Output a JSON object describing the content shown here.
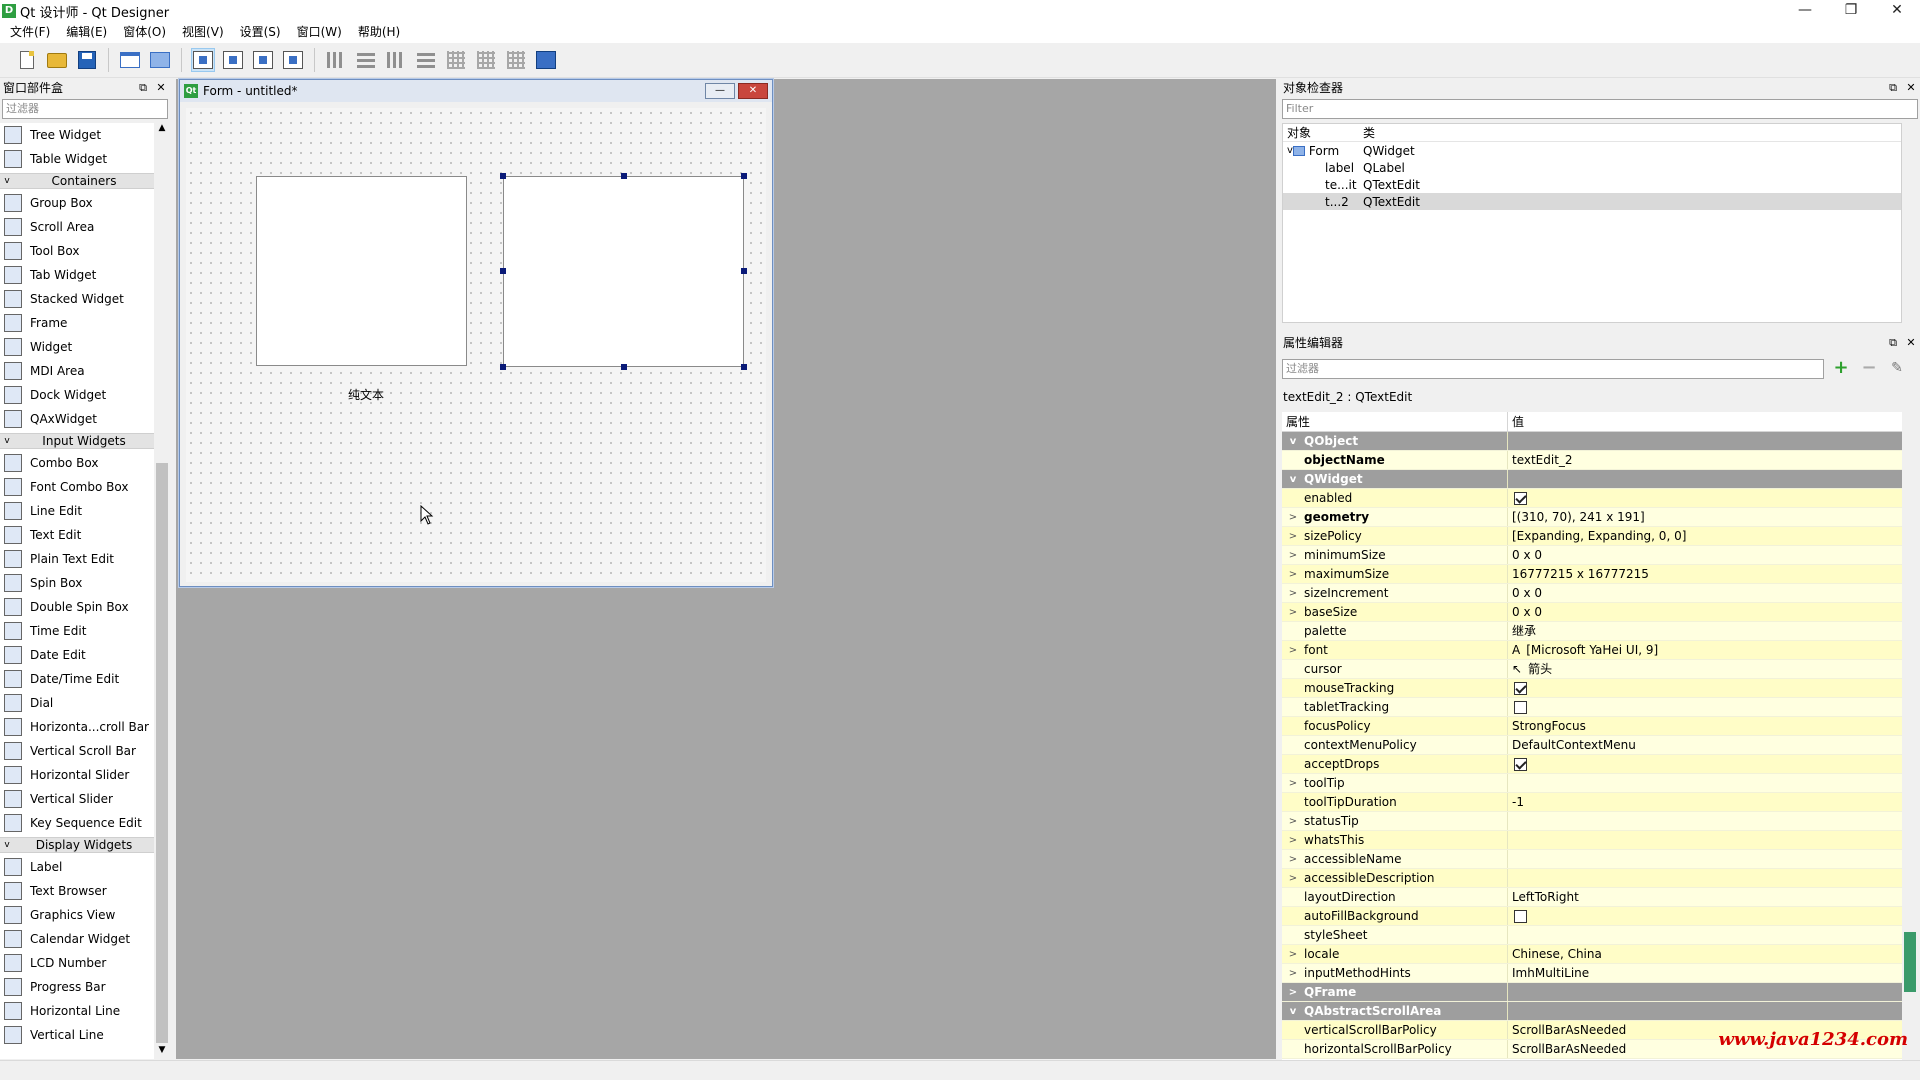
{
  "window": {
    "title": "Qt 设计师 - Qt Designer",
    "icon": "D"
  },
  "menu": [
    "文件(F)",
    "编辑(E)",
    "窗体(O)",
    "视图(V)",
    "设置(S)",
    "窗口(W)",
    "帮助(H)"
  ],
  "widget_box": {
    "title": "窗口部件盒",
    "filter_placeholder": "过滤器",
    "rows": [
      {
        "kind": "item",
        "label": "Tree Widget"
      },
      {
        "kind": "item",
        "label": "Table Widget"
      },
      {
        "kind": "cat",
        "label": "Containers"
      },
      {
        "kind": "item",
        "label": "Group Box"
      },
      {
        "kind": "item",
        "label": "Scroll Area"
      },
      {
        "kind": "item",
        "label": "Tool Box"
      },
      {
        "kind": "item",
        "label": "Tab Widget"
      },
      {
        "kind": "item",
        "label": "Stacked Widget"
      },
      {
        "kind": "item",
        "label": "Frame"
      },
      {
        "kind": "item",
        "label": "Widget"
      },
      {
        "kind": "item",
        "label": "MDI Area"
      },
      {
        "kind": "item",
        "label": "Dock Widget"
      },
      {
        "kind": "item",
        "label": "QAxWidget"
      },
      {
        "kind": "cat",
        "label": "Input Widgets"
      },
      {
        "kind": "item",
        "label": "Combo Box"
      },
      {
        "kind": "item",
        "label": "Font Combo Box"
      },
      {
        "kind": "item",
        "label": "Line Edit"
      },
      {
        "kind": "item",
        "label": "Text Edit"
      },
      {
        "kind": "item",
        "label": "Plain Text Edit"
      },
      {
        "kind": "item",
        "label": "Spin Box"
      },
      {
        "kind": "item",
        "label": "Double Spin Box"
      },
      {
        "kind": "item",
        "label": "Time Edit"
      },
      {
        "kind": "item",
        "label": "Date Edit"
      },
      {
        "kind": "item",
        "label": "Date/Time Edit"
      },
      {
        "kind": "item",
        "label": "Dial"
      },
      {
        "kind": "item",
        "label": "Horizonta...croll Bar"
      },
      {
        "kind": "item",
        "label": "Vertical Scroll Bar"
      },
      {
        "kind": "item",
        "label": "Horizontal Slider"
      },
      {
        "kind": "item",
        "label": "Vertical Slider"
      },
      {
        "kind": "item",
        "label": "Key Sequence Edit"
      },
      {
        "kind": "cat",
        "label": "Display Widgets"
      },
      {
        "kind": "item",
        "label": "Label"
      },
      {
        "kind": "item",
        "label": "Text Browser"
      },
      {
        "kind": "item",
        "label": "Graphics View"
      },
      {
        "kind": "item",
        "label": "Calendar Widget"
      },
      {
        "kind": "item",
        "label": "LCD Number"
      },
      {
        "kind": "item",
        "label": "Progress Bar"
      },
      {
        "kind": "item",
        "label": "Horizontal Line"
      },
      {
        "kind": "item",
        "label": "Vertical Line"
      }
    ]
  },
  "form": {
    "title": "Form - untitled*",
    "label_text": "纯文本"
  },
  "inspector": {
    "title": "对象检查器",
    "filter_placeholder": "Filter",
    "col_object": "对象",
    "col_class": "类",
    "rows": [
      {
        "obj": "Form",
        "cls": "QWidget"
      },
      {
        "obj": "label",
        "cls": "QLabel"
      },
      {
        "obj": "te...it",
        "cls": "QTextEdit"
      },
      {
        "obj": "t...2",
        "cls": "QTextEdit"
      }
    ]
  },
  "property_editor": {
    "title": "属性编辑器",
    "filter_placeholder": "过滤器",
    "object_line": "textEdit_2 : QTextEdit",
    "col_property": "属性",
    "col_value": "值",
    "rows": [
      {
        "type": "group",
        "name": "QObject",
        "exp": "v"
      },
      {
        "type": "prop",
        "name": "objectName",
        "value": "textEdit_2",
        "bold": true,
        "exp": ""
      },
      {
        "type": "group",
        "name": "QWidget",
        "exp": "v"
      },
      {
        "type": "prop",
        "name": "enabled",
        "check": true,
        "exp": ""
      },
      {
        "type": "prop",
        "name": "geometry",
        "value": "[(310, 70), 241 x 191]",
        "bold": true,
        "exp": ">"
      },
      {
        "type": "prop",
        "name": "sizePolicy",
        "value": "[Expanding, Expanding, 0, 0]",
        "exp": ">"
      },
      {
        "type": "prop",
        "name": "minimumSize",
        "value": "0 x 0",
        "exp": ">"
      },
      {
        "type": "prop",
        "name": "maximumSize",
        "value": "16777215 x 16777215",
        "exp": ">"
      },
      {
        "type": "prop",
        "name": "sizeIncrement",
        "value": "0 x 0",
        "exp": ">"
      },
      {
        "type": "prop",
        "name": "baseSize",
        "value": "0 x 0",
        "exp": ">"
      },
      {
        "type": "prop",
        "name": "palette",
        "value": "继承",
        "exp": ""
      },
      {
        "type": "prop",
        "name": "font",
        "value": "[Microsoft YaHei UI, 9]",
        "glyph": "A",
        "exp": ">"
      },
      {
        "type": "prop",
        "name": "cursor",
        "value": "箭头",
        "glyph": "↖",
        "exp": ""
      },
      {
        "type": "prop",
        "name": "mouseTracking",
        "check": true,
        "exp": ""
      },
      {
        "type": "prop",
        "name": "tabletTracking",
        "check": false,
        "exp": ""
      },
      {
        "type": "prop",
        "name": "focusPolicy",
        "value": "StrongFocus",
        "exp": ""
      },
      {
        "type": "prop",
        "name": "contextMenuPolicy",
        "value": "DefaultContextMenu",
        "exp": ""
      },
      {
        "type": "prop",
        "name": "acceptDrops",
        "check": true,
        "exp": ""
      },
      {
        "type": "prop",
        "name": "toolTip",
        "value": "",
        "exp": ">"
      },
      {
        "type": "prop",
        "name": "toolTipDuration",
        "value": "-1",
        "exp": ""
      },
      {
        "type": "prop",
        "name": "statusTip",
        "value": "",
        "exp": ">"
      },
      {
        "type": "prop",
        "name": "whatsThis",
        "value": "",
        "exp": ">"
      },
      {
        "type": "prop",
        "name": "accessibleName",
        "value": "",
        "exp": ">"
      },
      {
        "type": "prop",
        "name": "accessibleDescription",
        "value": "",
        "exp": ">"
      },
      {
        "type": "prop",
        "name": "layoutDirection",
        "value": "LeftToRight",
        "exp": ""
      },
      {
        "type": "prop",
        "name": "autoFillBackground",
        "check": false,
        "exp": ""
      },
      {
        "type": "prop",
        "name": "styleSheet",
        "value": "",
        "exp": ""
      },
      {
        "type": "prop",
        "name": "locale",
        "value": "Chinese, China",
        "exp": ">"
      },
      {
        "type": "prop",
        "name": "inputMethodHints",
        "value": "ImhMultiLine",
        "exp": ">"
      },
      {
        "type": "group",
        "name": "QFrame",
        "exp": ">"
      },
      {
        "type": "group",
        "name": "QAbstractScrollArea",
        "exp": "v"
      },
      {
        "type": "prop",
        "name": "verticalScrollBarPolicy",
        "value": "ScrollBarAsNeeded",
        "exp": ""
      },
      {
        "type": "prop",
        "name": "horizontalScrollBarPolicy",
        "value": "ScrollBarAsNeeded",
        "exp": ""
      }
    ]
  },
  "watermark": "www.java1234.com",
  "colors": {
    "group_bg": "#9e9e9e",
    "prop_bg": "#ffffe0",
    "selection": "#0a1a78"
  }
}
